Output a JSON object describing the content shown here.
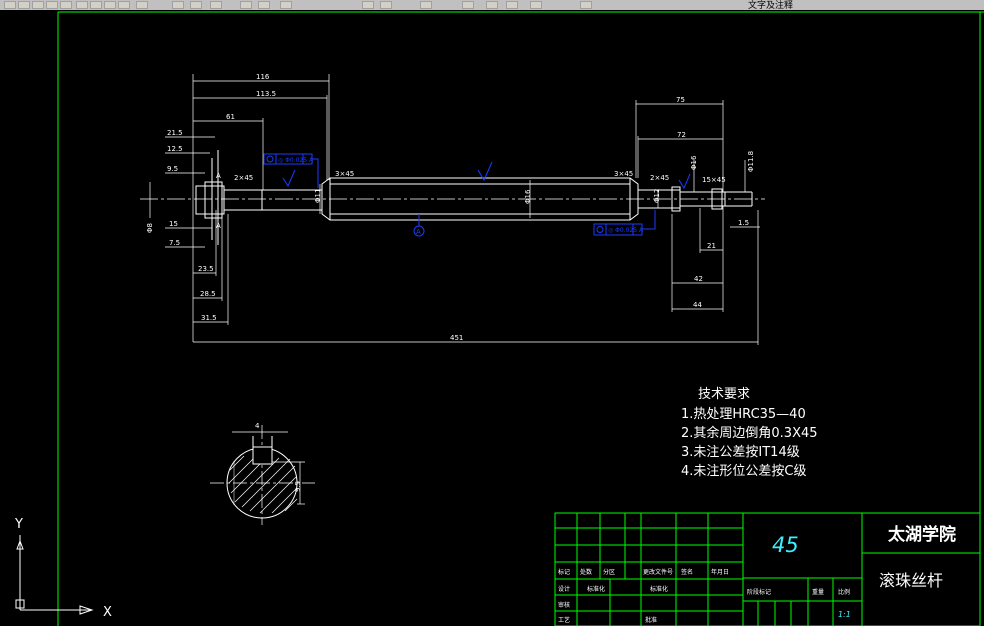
{
  "window": {
    "title_fragment": "文字及注释"
  },
  "toolbar": {
    "icons": [
      "new-icon",
      "open-icon",
      "save-icon",
      "print-icon",
      "preview-icon",
      "cut-icon",
      "copy-icon",
      "paste-icon",
      "match-icon",
      "undo-icon",
      "redo-icon",
      "pan-icon",
      "zoom-realtime-icon",
      "zoom-window-icon",
      "zoom-previous-icon",
      "properties-icon",
      "design-center-icon",
      "tool-palette-icon",
      "sheet-set-icon",
      "markup-icon",
      "calc-icon",
      "layer-icon",
      "text-style-icon",
      "dim-style-icon"
    ]
  },
  "drawing": {
    "dimensions": {
      "top_116": "116",
      "top_113_5": "113.5",
      "top_61": "61",
      "left_21_5": "21.5",
      "left_12_5": "12.5",
      "left_9_5": "9.5",
      "left_phi8": "Φ8",
      "left_15": "15",
      "left_7_5": "7.5",
      "bottom_23_5": "23.5",
      "bottom_28_5": "28.5",
      "bottom_31_5": "31.5",
      "overall_451": "451",
      "chamfer_2x45_left": "2×45",
      "chamfer_3x45_left": "3×45",
      "chamfer_3x45_right": "3×45",
      "chamfer_2x45_right": "2×45",
      "chamfer_15x45": "15×45",
      "right_75": "75",
      "right_72": "72",
      "right_phi16": "Φ16",
      "right_phi11_8": "Φ11.8",
      "right_1_5": "1.5",
      "right_21": "21",
      "right_42": "42",
      "right_44": "44",
      "center_diameter": "Φ16",
      "small_phi": "Φ11",
      "small_phi_right": "Φ12",
      "section_4": "4",
      "section_9_5": "9.5",
      "section_a": "A",
      "datum": "A"
    },
    "tolerance_frame_left": "◎ Φ0.025 A",
    "tolerance_frame_right": "◎ Φ0.025 A",
    "technical_requirements": {
      "heading": "技术要求",
      "items": [
        "1.热处理HRC35—40",
        "2.其余周边倒角0.3X45",
        "3.未注公差按IT14级",
        "4.未注形位公差按C级"
      ]
    },
    "ucs": {
      "y_label": "Y",
      "x_label": "X"
    }
  },
  "title_block": {
    "material": "45",
    "school": "太湖学院",
    "part_name": "滚珠丝杆",
    "row_labels": [
      "标记",
      "处数",
      "分区",
      "更改文件号",
      "签名",
      "年月日"
    ],
    "design_labels": [
      "设计",
      "标准化"
    ],
    "check_label": "审核",
    "process_label": "工艺",
    "approve_label": "批准",
    "stage_labels": [
      "阶段标记",
      "重量",
      "比例"
    ],
    "scale": "1:1",
    "colors": {
      "frame_green": "#00ff00",
      "linework": "#ffffff",
      "tolerance_blue": "#1a3cff",
      "material_cyan": "#3cf0ff"
    }
  }
}
